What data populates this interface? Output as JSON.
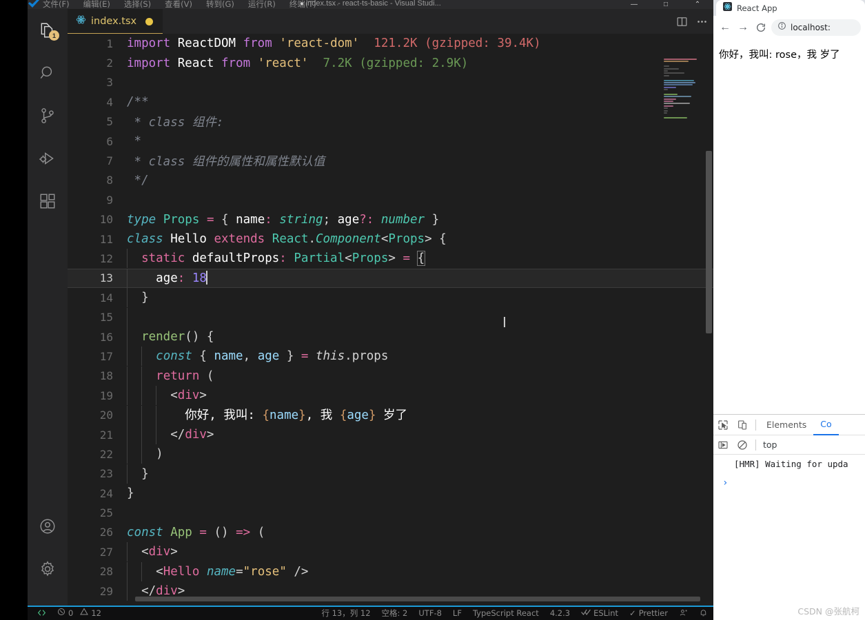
{
  "window": {
    "title": "index.tsx - react-ts-basic - Visual Studi...",
    "dirty_dot": "●",
    "minimize": "—",
    "maximize": "□",
    "restore": "⌃"
  },
  "menubar": {
    "items": [
      "文件(F)",
      "编辑(E)",
      "选择(S)",
      "查看(V)",
      "转到(G)",
      "运行(R)",
      "终端(T)"
    ],
    "overflow": "···"
  },
  "activitybar": {
    "items": [
      {
        "name": "explorer-icon",
        "badge": "1"
      },
      {
        "name": "search-icon",
        "badge": ""
      },
      {
        "name": "source-control-icon",
        "badge": ""
      },
      {
        "name": "run-debug-icon",
        "badge": ""
      },
      {
        "name": "extensions-icon",
        "badge": ""
      }
    ],
    "bottom": [
      {
        "name": "account-icon"
      },
      {
        "name": "settings-gear-icon"
      }
    ]
  },
  "editor": {
    "tab": {
      "label": "index.tsx",
      "icon": "react-icon",
      "dirty": true
    },
    "actions": [
      "split-editor-icon",
      "more-actions-icon"
    ],
    "cursor_glyph": "I",
    "lines": [
      {
        "n": 1,
        "tokens": [
          {
            "t": "import",
            "c": "kw"
          },
          {
            "t": " ",
            "c": "punc"
          },
          {
            "t": "ReactDOM",
            "c": "id"
          },
          {
            "t": " ",
            "c": "punc"
          },
          {
            "t": "from",
            "c": "kw"
          },
          {
            "t": " ",
            "c": "punc"
          },
          {
            "t": "'react-dom'",
            "c": "str"
          },
          {
            "t": "  ",
            "c": "punc"
          },
          {
            "t": "121.2K (gzipped: 39.4K)",
            "c": "size-red"
          }
        ]
      },
      {
        "n": 2,
        "tokens": [
          {
            "t": "import",
            "c": "kw"
          },
          {
            "t": " ",
            "c": "punc"
          },
          {
            "t": "React",
            "c": "id"
          },
          {
            "t": " ",
            "c": "punc"
          },
          {
            "t": "from",
            "c": "kw"
          },
          {
            "t": " ",
            "c": "punc"
          },
          {
            "t": "'react'",
            "c": "str"
          },
          {
            "t": "  ",
            "c": "punc"
          },
          {
            "t": "7.2K (gzipped: 2.9K)",
            "c": "size-green"
          }
        ]
      },
      {
        "n": 3,
        "tokens": []
      },
      {
        "n": 4,
        "tokens": [
          {
            "t": "/**",
            "c": "cmt"
          }
        ]
      },
      {
        "n": 5,
        "tokens": [
          {
            "t": " * class 组件:",
            "c": "cmt"
          }
        ]
      },
      {
        "n": 6,
        "tokens": [
          {
            "t": " *",
            "c": "cmt"
          }
        ]
      },
      {
        "n": 7,
        "tokens": [
          {
            "t": " * class 组件的属性和属性默认值",
            "c": "cmt"
          }
        ]
      },
      {
        "n": 8,
        "tokens": [
          {
            "t": " */",
            "c": "cmt"
          }
        ]
      },
      {
        "n": 9,
        "tokens": []
      },
      {
        "n": 10,
        "tokens": [
          {
            "t": "type",
            "c": "ctl"
          },
          {
            "t": " ",
            "c": "punc"
          },
          {
            "t": "Props",
            "c": "typ"
          },
          {
            "t": " ",
            "c": "punc"
          },
          {
            "t": "=",
            "c": "op"
          },
          {
            "t": " { ",
            "c": "punc"
          },
          {
            "t": "name",
            "c": "id"
          },
          {
            "t": ":",
            "c": "op"
          },
          {
            "t": " ",
            "c": "punc"
          },
          {
            "t": "string",
            "c": "typi"
          },
          {
            "t": "; ",
            "c": "punc"
          },
          {
            "t": "age",
            "c": "id"
          },
          {
            "t": "?:",
            "c": "op"
          },
          {
            "t": " ",
            "c": "punc"
          },
          {
            "t": "number",
            "c": "typi"
          },
          {
            "t": " }",
            "c": "punc"
          }
        ]
      },
      {
        "n": 11,
        "tokens": [
          {
            "t": "class",
            "c": "ctl"
          },
          {
            "t": " ",
            "c": "punc"
          },
          {
            "t": "Hello",
            "c": "id"
          },
          {
            "t": " ",
            "c": "punc"
          },
          {
            "t": "extends",
            "c": "kw2"
          },
          {
            "t": " ",
            "c": "punc"
          },
          {
            "t": "React",
            "c": "typ"
          },
          {
            "t": ".",
            "c": "punc"
          },
          {
            "t": "Component",
            "c": "typi"
          },
          {
            "t": "<",
            "c": "punc"
          },
          {
            "t": "Props",
            "c": "typ"
          },
          {
            "t": "> {",
            "c": "punc"
          }
        ]
      },
      {
        "n": 12,
        "indent": 1,
        "tokens": [
          {
            "t": "static",
            "c": "kw2"
          },
          {
            "t": " ",
            "c": "punc"
          },
          {
            "t": "defaultProps",
            "c": "id"
          },
          {
            "t": ":",
            "c": "op"
          },
          {
            "t": " ",
            "c": "punc"
          },
          {
            "t": "Partial",
            "c": "typ"
          },
          {
            "t": "<",
            "c": "punc"
          },
          {
            "t": "Props",
            "c": "typ"
          },
          {
            "t": ">",
            "c": "punc"
          },
          {
            "t": " ",
            "c": "punc"
          },
          {
            "t": "=",
            "c": "op"
          },
          {
            "t": " ",
            "c": "punc"
          },
          {
            "t": "{",
            "c": "bracketbox"
          }
        ]
      },
      {
        "n": 13,
        "indent": 1,
        "current": true,
        "tokens": [
          {
            "t": "  ",
            "c": "punc"
          },
          {
            "t": "age",
            "c": "id"
          },
          {
            "t": ":",
            "c": "op"
          },
          {
            "t": " ",
            "c": "punc"
          },
          {
            "t": "18",
            "c": "num"
          }
        ],
        "caret": true
      },
      {
        "n": 14,
        "indent": 1,
        "tokens": [
          {
            "t": "}",
            "c": "punc"
          }
        ]
      },
      {
        "n": 15,
        "indent": 1,
        "tokens": []
      },
      {
        "n": 16,
        "indent": 1,
        "tokens": [
          {
            "t": "render",
            "c": "fn"
          },
          {
            "t": "() {",
            "c": "punc"
          }
        ]
      },
      {
        "n": 17,
        "indent": 2,
        "tokens": [
          {
            "t": "const",
            "c": "ctl"
          },
          {
            "t": " { ",
            "c": "punc"
          },
          {
            "t": "name",
            "c": "var"
          },
          {
            "t": ", ",
            "c": "punc"
          },
          {
            "t": "age",
            "c": "var"
          },
          {
            "t": " } ",
            "c": "punc"
          },
          {
            "t": "=",
            "c": "op"
          },
          {
            "t": " ",
            "c": "punc"
          },
          {
            "t": "this",
            "c": "this"
          },
          {
            "t": ".props",
            "c": "punc"
          }
        ]
      },
      {
        "n": 18,
        "indent": 2,
        "tokens": [
          {
            "t": "return",
            "c": "kw2"
          },
          {
            "t": " (",
            "c": "punc"
          }
        ]
      },
      {
        "n": 19,
        "indent": 3,
        "tokens": [
          {
            "t": "<",
            "c": "punc"
          },
          {
            "t": "div",
            "c": "tag"
          },
          {
            "t": ">",
            "c": "punc"
          }
        ]
      },
      {
        "n": 20,
        "indent": 3,
        "tokens": [
          {
            "t": "  你好, 我叫: ",
            "c": "id"
          },
          {
            "t": "{",
            "c": "brace"
          },
          {
            "t": "name",
            "c": "var"
          },
          {
            "t": "}",
            "c": "brace"
          },
          {
            "t": ", 我 ",
            "c": "id"
          },
          {
            "t": "{",
            "c": "brace"
          },
          {
            "t": "age",
            "c": "var"
          },
          {
            "t": "}",
            "c": "brace"
          },
          {
            "t": " 岁了",
            "c": "id"
          }
        ]
      },
      {
        "n": 21,
        "indent": 3,
        "tokens": [
          {
            "t": "</",
            "c": "punc"
          },
          {
            "t": "div",
            "c": "tag"
          },
          {
            "t": ">",
            "c": "punc"
          }
        ]
      },
      {
        "n": 22,
        "indent": 2,
        "tokens": [
          {
            "t": ")",
            "c": "punc"
          }
        ]
      },
      {
        "n": 23,
        "indent": 1,
        "tokens": [
          {
            "t": "}",
            "c": "punc"
          }
        ]
      },
      {
        "n": 24,
        "tokens": [
          {
            "t": "}",
            "c": "punc"
          }
        ]
      },
      {
        "n": 25,
        "tokens": []
      },
      {
        "n": 26,
        "tokens": [
          {
            "t": "const",
            "c": "ctl"
          },
          {
            "t": " ",
            "c": "punc"
          },
          {
            "t": "App",
            "c": "fn"
          },
          {
            "t": " ",
            "c": "punc"
          },
          {
            "t": "=",
            "c": "op"
          },
          {
            "t": " () ",
            "c": "punc"
          },
          {
            "t": "=>",
            "c": "op"
          },
          {
            "t": " (",
            "c": "punc"
          }
        ]
      },
      {
        "n": 27,
        "indent": 1,
        "tokens": [
          {
            "t": "<",
            "c": "punc"
          },
          {
            "t": "div",
            "c": "tag"
          },
          {
            "t": ">",
            "c": "punc"
          }
        ]
      },
      {
        "n": 28,
        "indent": 2,
        "tokens": [
          {
            "t": "<",
            "c": "punc"
          },
          {
            "t": "Hello",
            "c": "tag"
          },
          {
            "t": " ",
            "c": "punc"
          },
          {
            "t": "name",
            "c": "attr"
          },
          {
            "t": "=",
            "c": "punc"
          },
          {
            "t": "\"rose\"",
            "c": "str"
          },
          {
            "t": " />",
            "c": "punc"
          }
        ]
      },
      {
        "n": 29,
        "indent": 1,
        "tokens": [
          {
            "t": "</",
            "c": "punc"
          },
          {
            "t": "div",
            "c": "tag"
          },
          {
            "t": ">",
            "c": "punc"
          }
        ]
      }
    ]
  },
  "statusbar": {
    "remote_icon": "remote-window-icon",
    "errors_icon": "error-icon",
    "errors": "0",
    "warnings_icon": "warning-icon",
    "warnings": "12",
    "position": "行 13，列 12",
    "indent": "空格: 2",
    "encoding": "UTF-8",
    "eol": "LF",
    "language": "TypeScript React",
    "version": "4.2.3",
    "eslint": "ESLint",
    "prettier": "Prettier",
    "prettier_check": "✓",
    "account_icon": "account-icon",
    "bell_icon": "bell-icon"
  },
  "browser": {
    "tab": {
      "title": "React App",
      "favicon": "react-icon"
    },
    "toolbar": {
      "back": "←",
      "forward": "→",
      "reload": "↻",
      "info_icon": "info-circle-icon"
    },
    "omnibox": {
      "value": "localhost:"
    },
    "page": {
      "text": "你好，我叫: rose，我 岁了"
    },
    "devtools": {
      "inspect_icon": "inspect-element-icon",
      "device_icon": "device-toolbar-icon",
      "tabs": [
        {
          "label": "Elements",
          "active": false
        },
        {
          "label": "Co",
          "active": true
        }
      ],
      "execute_icon": "eager-eval-icon",
      "clear_icon": "clear-console-icon",
      "context": "top",
      "messages": [
        "[HMR] Waiting for upda"
      ],
      "prompt": "›"
    }
  },
  "watermark": {
    "text": "CSDN @张航柯"
  },
  "colors": {
    "accent_tab": "#c5a353",
    "dirty_dot": "#e8c547",
    "statusbar_line": "#1b9bd8",
    "devtools_active": "#1a73e8",
    "badge": "#e5c07b"
  }
}
